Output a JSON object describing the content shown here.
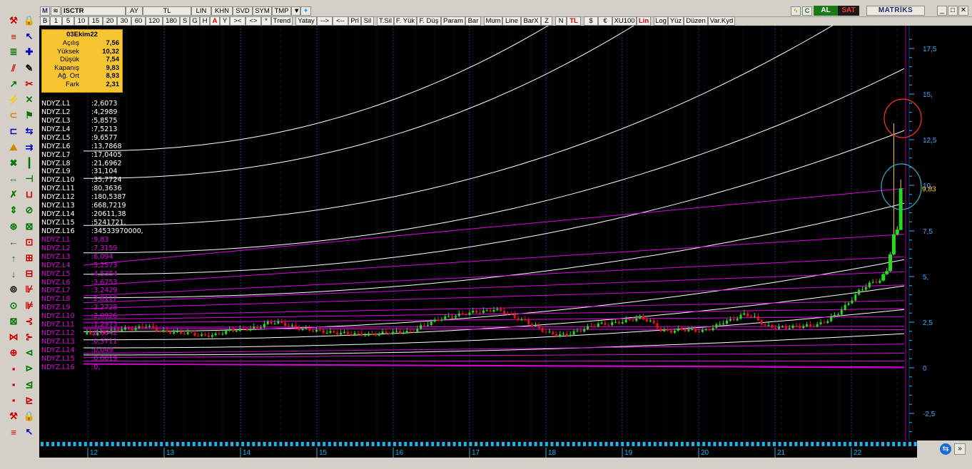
{
  "toolbar": {
    "m_label": "M",
    "symbol": "ISCTR",
    "period": "AY",
    "currency": "TL",
    "scale": "LIN",
    "khn": "KHN",
    "svd": "SVD",
    "sym": "SYM",
    "tmp": "TMP",
    "al": "AL",
    "sat": "SAT",
    "brand": "MATRİKS"
  },
  "buttons": [
    "B",
    "1",
    "5",
    "10",
    "15",
    "20",
    "30",
    "60",
    "120",
    "180",
    "S",
    "G",
    "H",
    "A",
    "Y",
    "><",
    "<>",
    "*",
    "Trend",
    "Yatay",
    "-->",
    "<--",
    "Prl",
    "Sil",
    "T.Sil",
    "F. Yük",
    "F. Düş",
    "Param",
    "Bar",
    "Mum",
    "Line",
    "BarX",
    "Z",
    "N",
    "TL",
    "$",
    "€",
    "XU100",
    "Lin",
    "Log",
    "Yüz",
    "Düzen",
    "Var.Kyd"
  ],
  "info": {
    "date": "03Ekim22",
    "rows": [
      {
        "k": "Açılış",
        "v": "7,56"
      },
      {
        "k": "Yüksek",
        "v": "10,32"
      },
      {
        "k": "Düşük",
        "v": "7,54"
      },
      {
        "k": "Kapanış",
        "v": "9,83"
      },
      {
        "k": "Ağ. Ort",
        "v": "8,93"
      },
      {
        "k": "Fark",
        "v": "2,31"
      }
    ]
  },
  "levels_up": [
    {
      "n": "NDYZ.L1",
      "v": ":2,6073"
    },
    {
      "n": "NDYZ.L2",
      "v": ":4,2989"
    },
    {
      "n": "NDYZ.L3",
      "v": ":5,8575"
    },
    {
      "n": "NDYZ.L4",
      "v": ":7,5213"
    },
    {
      "n": "NDYZ.L5",
      "v": ":9,6577"
    },
    {
      "n": "NDYZ.L6",
      "v": ":13,7868"
    },
    {
      "n": "NDYZ.L7",
      "v": ":17,0405"
    },
    {
      "n": "NDYZ.L8",
      "v": ":21,6962"
    },
    {
      "n": "NDYZ.L9",
      "v": ":31,104"
    },
    {
      "n": "NDYZ.L10",
      "v": ":35,7724"
    },
    {
      "n": "NDYZ.L11",
      "v": ":80,3636"
    },
    {
      "n": "NDYZ.L12",
      "v": ":180,5387"
    },
    {
      "n": "NDYZ.L13",
      "v": ":668,7219"
    },
    {
      "n": "NDYZ.L14",
      "v": ":20611,38"
    },
    {
      "n": "NDYZ.L15",
      "v": ":5241721,"
    },
    {
      "n": "NDYZ.L16",
      "v": ":34533970000,"
    }
  ],
  "levels_down": [
    {
      "n": "NDYZ.L1",
      "v": ":9,83"
    },
    {
      "n": "NDYZ.L2",
      "v": ":7,3159"
    },
    {
      "n": "NDYZ.L3",
      "v": ":6,094"
    },
    {
      "n": "NDYZ.L4",
      "v": ":5,2573"
    },
    {
      "n": "NDYZ.L5",
      "v": ":4,5354"
    },
    {
      "n": "NDYZ.L6",
      "v": ":3,6753"
    },
    {
      "n": "NDYZ.L7",
      "v": ":3,2429"
    },
    {
      "n": "NDYZ.L8",
      "v": ":2,8117"
    },
    {
      "n": "NDYZ.L9",
      "v": ":2,2728"
    },
    {
      "n": "NDYZ.L10",
      "v": ":2,0926"
    },
    {
      "n": "NDYZ.L11",
      "v": ":1,2973"
    },
    {
      "n": "NDYZ.L12",
      "v": ":0,8042"
    },
    {
      "n": "NDYZ.L13",
      "v": ":0,3711"
    },
    {
      "n": "NDYZ.L14",
      "v": ":0,049"
    },
    {
      "n": "NDYZ.L15",
      "v": ":0,0019"
    },
    {
      "n": "NDYZ.L16",
      "v": ":0,"
    }
  ],
  "colors": {
    "up": "#ffffff",
    "down": "#e000e0",
    "bull": "#22dd22",
    "bear": "#ee1111",
    "grid": "#1c3a7a",
    "axis": "#33aaff"
  },
  "chart_data": {
    "type": "candlestick",
    "y_ticks": [
      "17,5",
      "15,",
      "12,5",
      "10,",
      "7,5",
      "5,",
      "2,5",
      "0",
      "-2,5"
    ],
    "y_tick_values": [
      17.5,
      15,
      12.5,
      10,
      7.5,
      5,
      2.5,
      0,
      -2.5
    ],
    "ylim": [
      -4,
      18.5
    ],
    "last_price": "9,83",
    "x_ticks": [
      "12",
      "13",
      "14",
      "15",
      "16",
      "17",
      "18",
      "19",
      "20",
      "21",
      "22"
    ],
    "last_candle": {
      "open": 7.56,
      "high": 10.32,
      "low": 7.54,
      "close": 9.83
    },
    "price_path": [
      [
        0,
        1.85
      ],
      [
        5,
        1.9
      ],
      [
        10,
        2.1
      ],
      [
        15,
        2.15
      ],
      [
        18,
        2.3
      ],
      [
        22,
        2.0
      ],
      [
        25,
        1.95
      ],
      [
        30,
        1.9
      ],
      [
        34,
        1.75
      ],
      [
        38,
        1.8
      ],
      [
        42,
        2.05
      ],
      [
        46,
        2.1
      ],
      [
        50,
        2.2
      ],
      [
        53,
        2.45
      ],
      [
        56,
        2.5
      ],
      [
        59,
        2.3
      ],
      [
        62,
        2.15
      ],
      [
        66,
        2.05
      ],
      [
        70,
        1.95
      ],
      [
        74,
        1.9
      ],
      [
        78,
        1.85
      ],
      [
        82,
        1.8
      ],
      [
        86,
        1.9
      ],
      [
        90,
        1.95
      ],
      [
        94,
        1.95
      ],
      [
        97,
        2.25
      ],
      [
        100,
        2.5
      ],
      [
        104,
        2.75
      ],
      [
        108,
        2.9
      ],
      [
        112,
        3.05
      ],
      [
        116,
        3.1
      ],
      [
        118,
        3.2
      ],
      [
        121,
        3.05
      ],
      [
        124,
        2.75
      ],
      [
        127,
        2.55
      ],
      [
        130,
        2.25
      ],
      [
        133,
        1.95
      ],
      [
        136,
        1.8
      ],
      [
        139,
        1.8
      ],
      [
        142,
        2.0
      ],
      [
        145,
        2.2
      ],
      [
        148,
        2.4
      ],
      [
        151,
        2.4
      ],
      [
        154,
        2.5
      ],
      [
        157,
        2.6
      ],
      [
        160,
        2.75
      ],
      [
        163,
        2.55
      ],
      [
        166,
        2.05
      ],
      [
        169,
        2.0
      ],
      [
        172,
        2.1
      ],
      [
        175,
        2.05
      ],
      [
        178,
        2.0
      ],
      [
        181,
        2.2
      ],
      [
        184,
        2.5
      ],
      [
        187,
        2.65
      ],
      [
        190,
        2.95
      ],
      [
        193,
        2.75
      ],
      [
        196,
        2.3
      ],
      [
        199,
        2.2
      ],
      [
        202,
        2.2
      ],
      [
        205,
        2.25
      ],
      [
        208,
        2.3
      ],
      [
        211,
        2.35
      ],
      [
        214,
        2.6
      ],
      [
        217,
        3.0
      ],
      [
        220,
        3.55
      ],
      [
        223,
        4.2
      ],
      [
        226,
        4.6
      ],
      [
        229,
        4.8
      ],
      [
        231,
        5.3
      ],
      [
        233,
        7.3
      ],
      [
        234,
        7.5
      ],
      [
        235,
        9.83
      ]
    ]
  }
}
